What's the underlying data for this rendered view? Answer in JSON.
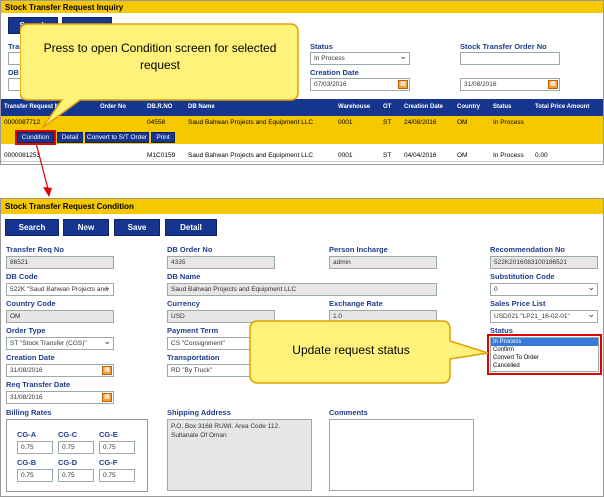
{
  "inquiry": {
    "title": "Stock Transfer Request Inquiry",
    "search_btn": "Search",
    "transfer_label": "Transfer",
    "db_order_label": "DB Or",
    "status_label": "Status",
    "status_value": "In Process",
    "st_order_label": "Stock Transfer Order No",
    "creation_label": "Creation Date",
    "date_from": "07/03/2016",
    "date_to": "31/08/2016",
    "headers": [
      "Transfer Request No",
      "Order No",
      "DB.R.NO",
      "DB Name",
      "Warehouse",
      "OT",
      "Creation Date",
      "Country",
      "Status",
      "Total Price Amount"
    ],
    "rows": [
      [
        "0000087712",
        "",
        "04558",
        "Saud Bahwan Projects and Equipment LLC",
        "0001",
        "ST",
        "24/08/2016",
        "OM",
        "In Process",
        ""
      ],
      [
        "0000081253",
        "",
        "M1C0159",
        "Saud Bahwan Projects and Equipment LLC",
        "0001",
        "ST",
        "04/04/2016",
        "OM",
        "In Process",
        "0.00"
      ]
    ],
    "row_actions": [
      "Condition",
      "Detail",
      "Convert to S/T Order",
      "Print"
    ]
  },
  "callout1": "Press to open Condition screen for selected request",
  "callout2": "Update request status",
  "condition": {
    "title": "Stock Transfer Request Condition",
    "buttons": [
      "Search",
      "New",
      "Save",
      "Detail"
    ],
    "fields": {
      "transfer_req_no": {
        "label": "Transfer Req No",
        "value": "86521"
      },
      "db_order_no": {
        "label": "DB Order No",
        "value": "4335"
      },
      "person_incharge": {
        "label": "Person Incharge",
        "value": "admin"
      },
      "recommendation_no": {
        "label": "Recommendation No",
        "value": "522K2016083100186521"
      },
      "db_code": {
        "label": "DB Code",
        "value": "522K \"Saud Bahwan Projects and"
      },
      "db_name": {
        "label": "DB Name",
        "value": "Saud Bahwan Projects and Equipment LLC"
      },
      "substitution_code": {
        "label": "Substitution Code",
        "value": "0"
      },
      "country_code": {
        "label": "Country Code",
        "value": "OM"
      },
      "currency": {
        "label": "Currency",
        "value": "USD"
      },
      "exchange_rate": {
        "label": "Exchange Rate",
        "value": "1.0"
      },
      "sales_price_list": {
        "label": "Sales Price List",
        "value": "USD021 \"LP21_16-02-01\""
      },
      "order_type": {
        "label": "Order Type",
        "value": "ST \"Stock Transfer (CGS)\""
      },
      "payment_term": {
        "label": "Payment Term",
        "value": "CS \"Consignment\""
      },
      "status": {
        "label": "Status"
      },
      "creation_date": {
        "label": "Creation Date",
        "value": "31/08/2016"
      },
      "transportation": {
        "label": "Transportation",
        "value": "RD \"By Truck\""
      },
      "req_transfer_date": {
        "label": "Req Transfer Date",
        "value": "31/08/2016"
      },
      "billing_rates": {
        "label": "Billing Rates"
      },
      "shipping_address": {
        "label": "Shipping Address",
        "value": "P.O. Box 3168 RUWI. Area Code 112. Sultanate Of Oman"
      },
      "comments": {
        "label": "Comments",
        "value": ""
      }
    },
    "status_options": [
      "In Process",
      "Confirm",
      "Convert To Order",
      "Cancelled"
    ],
    "rates": [
      {
        "label": "CG-A",
        "value": "0.75"
      },
      {
        "label": "CG-C",
        "value": "0.75"
      },
      {
        "label": "CG-E",
        "value": "0.75"
      },
      {
        "label": "CG-B",
        "value": "0.75"
      },
      {
        "label": "CG-D",
        "value": "0.75"
      },
      {
        "label": "CG-F",
        "value": "0.75"
      }
    ]
  },
  "colors": {
    "title_bar": "#f5c800",
    "button": "#15358f",
    "callout": "#fff27a",
    "highlight": "#e00000"
  }
}
